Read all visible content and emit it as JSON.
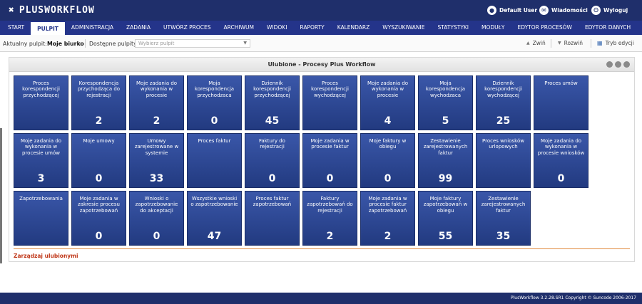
{
  "app": {
    "logo_text": "PLUSWORKFLOW",
    "logo_mark": "✖"
  },
  "header": {
    "user_label": "Default User",
    "messages_label": "Wiadomości",
    "logout_label": "Wyloguj"
  },
  "menu": [
    {
      "label": "START"
    },
    {
      "label": "PULPIT",
      "active": true
    },
    {
      "label": "ADMINISTRACJA"
    },
    {
      "label": "ZADANIA"
    },
    {
      "label": "UTWÓRZ PROCES"
    },
    {
      "label": "ARCHIWUM"
    },
    {
      "label": "WIDOKI"
    },
    {
      "label": "RAPORTY"
    },
    {
      "label": "KALENDARZ"
    },
    {
      "label": "WYSZUKIWANIE"
    },
    {
      "label": "STATYSTYKI"
    },
    {
      "label": "MODUŁY"
    },
    {
      "label": "EDYTOR PROCESÓW"
    },
    {
      "label": "EDYTOR DANYCH"
    }
  ],
  "toolbar": {
    "current_label": "Aktualny pulpit:",
    "current_value": "Moje biurko",
    "available_label": "Dostępne pulpity:",
    "select_placeholder": "Wybierz pulpit",
    "collapse_label": "Zwiń",
    "expand_label": "Rozwiń",
    "edit_mode_label": "Tryb edycji"
  },
  "panel": {
    "title": "Ulubione - Procesy Plus Workflow",
    "manage_label": "Zarządzaj ulubionymi"
  },
  "tiles": [
    {
      "title": "Proces korespondencji przychodzącej",
      "value": ""
    },
    {
      "title": "Korespondencja przychodząca do rejestracji",
      "value": "2"
    },
    {
      "title": "Moje zadania do wykonania w procesie",
      "value": "2"
    },
    {
      "title": "Moja korespondencja przychodzaca",
      "value": "0"
    },
    {
      "title": "Dziennik korespondencji przychodzącej",
      "value": "45"
    },
    {
      "title": "Proces korespondencji wychodzącej",
      "value": ""
    },
    {
      "title": "Moje zadania do wykonania w procesie",
      "value": "4"
    },
    {
      "title": "Moja korespondencja wychodzaca",
      "value": "5"
    },
    {
      "title": "Dziennik korespondencji wychodzącej",
      "value": "25"
    },
    {
      "title": "Proces umów",
      "value": ""
    },
    {
      "title": "Moje zadania do wykonania w procesie umów",
      "value": "3"
    },
    {
      "title": "Moje umowy",
      "value": "0"
    },
    {
      "title": "Umowy zarejestrowane w systemie",
      "value": "33"
    },
    {
      "title": "Proces faktur",
      "value": ""
    },
    {
      "title": "Faktury do rejestracji",
      "value": "0"
    },
    {
      "title": "Moje zadania w procesie faktur",
      "value": "0"
    },
    {
      "title": "Moje faktury w obiegu",
      "value": "0"
    },
    {
      "title": "Zestawienie zarejestrowanych faktur",
      "value": "99"
    },
    {
      "title": "Proces wniosków urlopowych",
      "value": ""
    },
    {
      "title": "Moje zadania do wykonania w procesie wniosków",
      "value": "0"
    },
    {
      "title": "Zapotrzebowania",
      "value": ""
    },
    {
      "title": "Moje zadania w zakresie procesu zapotrzebowań",
      "value": "0"
    },
    {
      "title": "Wnioski o zapotrzebowanie do akceptacji",
      "value": "0"
    },
    {
      "title": "Wszystkie wnioski o zapotrzebowanie",
      "value": "47"
    },
    {
      "title": "Proces faktur zapotrzebowań",
      "value": ""
    },
    {
      "title": "Faktury zapotrzebowań do rejestracji",
      "value": "2"
    },
    {
      "title": "Moje zadania w procesie faktur zapotrzebowań",
      "value": "2"
    },
    {
      "title": "Moje faktury zapotrzebowań w obiegu",
      "value": "55"
    },
    {
      "title": "Zestawienie zarejestrowanych faktur",
      "value": "35"
    }
  ],
  "footer": {
    "text": "PlusWorkflow 3.2.28.SR1 Copyright © Suncode 2006-2017"
  }
}
